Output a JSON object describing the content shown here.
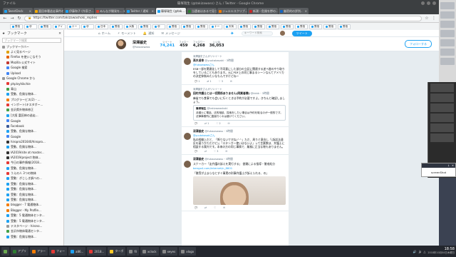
{
  "window": {
    "title": "篠塚瑞生 (@takizawass) さん / Twitter - Google Chrome",
    "menu_file": "ファイル"
  },
  "tabs": [
    {
      "label": "TweetDeck",
      "color": "#1da1f2"
    },
    {
      "label": "富田林署逃走事件の...",
      "color": "#f2a900"
    },
    {
      "label": "伊藤和子 (作家さ...",
      "color": "#1da1f2"
    },
    {
      "label": "みんなが開発を...",
      "color": "#d34836"
    },
    {
      "label": "Twitter / 通知",
      "color": "#1da1f2"
    },
    {
      "label": "篠塚瑞生 (@tak...",
      "color": "#1da1f2",
      "active": true
    },
    {
      "label": "当選者はあるで見ら...",
      "color": "#2e7d32"
    },
    {
      "label": "ジュエルスクリプ...",
      "color": "#f57c00"
    },
    {
      "label": "新潮・危険を惨の...",
      "color": "#c62828"
    },
    {
      "label": "厳密的の評判..",
      "color": "#1565c0"
    }
  ],
  "bookmark_chips": [
    "受信",
    "@",
    "受信",
    "アイ",
    "ナー",
    "@",
    "日本",
    "受信",
    "大阪",
    "受信",
    "@",
    "受信",
    "受信",
    "受信",
    "ナー",
    "天気",
    "受信",
    "受信",
    "受信",
    "受信",
    "受信",
    "受信",
    "受信",
    "受信"
  ],
  "url": "https://twitter.com/takizawashoki_replies",
  "bookmarks_panel": {
    "title": "ブックマーク",
    "search_placeholder": "ブックマーク検索",
    "items": [
      {
        "label": "ブックマークバー",
        "color": "#999"
      },
      {
        "label": "よく見るページ",
        "color": "#e0a000"
      },
      {
        "label": "Firefox を使いこなそう",
        "color": "#e66000"
      },
      {
        "label": "Mozilla 公式サイト",
        "color": "#c13832"
      },
      {
        "label": "Google 検索",
        "color": "#4285f4"
      },
      {
        "label": "Upload",
        "color": "#4285f4"
      },
      {
        "label": "Google Chrome から",
        "color": "#999"
      },
      {
        "label": "phplvyhikchie",
        "color": "#e53935"
      },
      {
        "label": "青山",
        "color": "#43a047"
      },
      {
        "label": "受動、危険な物体...",
        "color": "#1da1f2"
      },
      {
        "label": "プログラービス(2) - ...",
        "color": "#f57c00"
      },
      {
        "label": "インポート(キスタポー...",
        "color": "#e53935"
      },
      {
        "label": "金沢県外物体修正",
        "color": "#43a047"
      },
      {
        "label": "[大阪 富田林の逃走...",
        "color": "#1da1f2"
      },
      {
        "label": "Google",
        "color": "#4285f4"
      },
      {
        "label": "Facebook",
        "color": "#3b5998"
      },
      {
        "label": "受動、危険な物体...",
        "color": "#1da1f2"
      },
      {
        "label": "Google",
        "color": "#4285f4"
      },
      {
        "label": "hiropro201640/hiropro...",
        "color": "#333"
      },
      {
        "label": "受動、危険な物体...",
        "color": "#1da1f2"
      },
      {
        "label": "IA2019/site at master...",
        "color": "#333"
      },
      {
        "label": "IA2019/project 物体...",
        "color": "#333"
      },
      {
        "label": "今日の事件情報(2018...",
        "color": "#e53935"
      },
      {
        "label": "受動、危険な物体...",
        "color": "#1da1f2"
      },
      {
        "label": "うえの人 3つの物体",
        "color": "#e53935"
      },
      {
        "label": "受動：ぎじしき調べの...",
        "color": "#1da1f2"
      },
      {
        "label": "受動：危険な物体...",
        "color": "#1da1f2"
      },
      {
        "label": "受動：危険な物体...",
        "color": "#1da1f2"
      },
      {
        "label": "受動：危険な物体...",
        "color": "#1da1f2"
      },
      {
        "label": "受動：危険な物体...",
        "color": "#1da1f2"
      },
      {
        "label": "blogger - 7 電通物体...",
        "color": "#f57c00"
      },
      {
        "label": "Blogger - My Profile...",
        "color": "#f57c00"
      },
      {
        "label": "受動：5 電通物体センタ...",
        "color": "#1da1f2"
      },
      {
        "label": "受動：5 電通物体センタ...",
        "color": "#1da1f2"
      },
      {
        "label": "テスタページ - hirono...",
        "color": "#999"
      },
      {
        "label": "金沢市物体電通センタ...",
        "color": "#43a047"
      },
      {
        "label": "受動：危険な物体...",
        "color": "#1da1f2"
      }
    ]
  },
  "twitter_nav": {
    "home": "ホーム",
    "moments": "モーメント",
    "notifications": "通知",
    "messages": "メッセージ",
    "search_placeholder": "キーワード検索",
    "tweet_button": "ツイート"
  },
  "profile": {
    "name": "深澤諭史",
    "handle": "@fukazawass",
    "stats": [
      {
        "label": "ツイート",
        "value": "74,241",
        "active": true
      },
      {
        "label": "フォロー",
        "value": "459"
      },
      {
        "label": "フォロワー",
        "value": "4,268"
      },
      {
        "label": "いいね",
        "value": "36,053"
      }
    ],
    "follow_label": "フォローする"
  },
  "tweets": [
    {
      "retweet_line": "深澤諭史さんがリツイート",
      "name": "高木貞幸",
      "handle": "@yuutakasaki",
      "time": "3時間",
      "reply_to": "@fukazawassさん",
      "body": "ESB一部を関連化して不同意にした部分の立証に関連する述べ書のやり取りをしていることもあります。元にPDF上の同じ事まるシーンなんてアメリカの決定抑制みたいなもんですけどね～",
      "counts": [
        "1",
        "1",
        "3"
      ]
    },
    {
      "retweet_line": "深澤諭史さんがリツイート",
      "name": "田村弁護士とは一切関係ありません(同業者様)",
      "handle": "@kkkk",
      "time": "3時間",
      "body": "麻雀でも食事でも会いに行くときは予約が必要ですよ。きちんと確認しましょう。",
      "quote": {
        "name": "篠塚瑞生",
        "handle": "@takizawashoki",
        "body": "弁護士に電話、法的相談、探索をしたい場合は予約を取るのが一般的です。法律事務所に直接行くのは避けてください。"
      },
      "counts": [
        "",
        "1",
        "2"
      ]
    },
    {
      "retweet_line": "",
      "name": "深澤諭史",
      "handle": "@fukazawass",
      "time": "3時間",
      "reply_to": "@yuutakasakiさん",
      "body": "私の経験上だと、「断りないですね(^^」ただ、周りと意向し「(訴訟法違反を疑うかただけど)」「スタンガー使いはないよ」って言葉数は、弁護士に相談する案内です。本来の方の同じ事情で、業務に正当な物もありません。",
      "counts": [
        "",
        "",
        "3"
      ]
    },
    {
      "retweet_line": "",
      "name": "深澤諭史",
      "handle": "@fukazawass",
      "time": "3時間",
      "body": "スナーカー「友弁護の訴えを実行する」 書類による指導・懲戒処分",
      "link": "bengo4.com/internet/n_8601",
      "body2": "「懲罰が止まらなとすぐ事実の刑事弁護士が訴えられる、の」",
      "counts": [
        "",
        "",
        ""
      ]
    }
  ],
  "toast": {
    "label": "screenShot"
  },
  "taskbar": {
    "items": [
      {
        "label": "アプリ",
        "color": "#2e7d32"
      },
      {
        "label": "アラー",
        "color": "#f57c00"
      },
      {
        "label": "フォー",
        "color": "#e53935"
      },
      {
        "label": "a86...",
        "color": "#1da1f2"
      },
      {
        "label": "2018...",
        "color": "#e53935"
      },
      {
        "label": "ターボ",
        "color": "#ffca28"
      },
      {
        "label": "fil",
        "color": "#888"
      },
      {
        "label": "xclock",
        "color": "#888"
      },
      {
        "label": "xeyes",
        "color": "#888"
      },
      {
        "label": "xlogo",
        "color": "#888"
      }
    ],
    "lang": "jp",
    "time": "18:58",
    "date": "2018年10月04日木曜日"
  }
}
